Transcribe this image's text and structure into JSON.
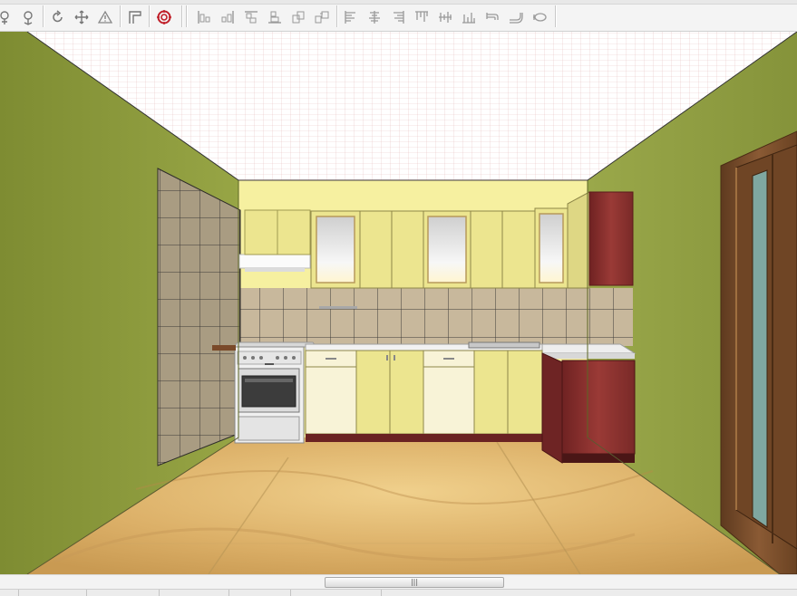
{
  "toolbar": {
    "buttons": [
      {
        "name": "pan-icon"
      },
      {
        "name": "orbit-icon"
      },
      {
        "name": "rotate-icon"
      },
      {
        "name": "move-icon"
      },
      {
        "name": "warning-icon"
      },
      {
        "name": "wall-icon"
      },
      {
        "name": "target-icon"
      },
      {
        "name": "align-left-edges-icon"
      },
      {
        "name": "align-right-edges-icon"
      },
      {
        "name": "align-top-edges-icon"
      },
      {
        "name": "align-bottom-edges-icon"
      },
      {
        "name": "group-icon"
      },
      {
        "name": "ungroup-icon"
      },
      {
        "name": "align-left-icon"
      },
      {
        "name": "align-center-icon"
      },
      {
        "name": "align-right-icon"
      },
      {
        "name": "distribute-top-icon"
      },
      {
        "name": "distribute-middle-icon"
      },
      {
        "name": "distribute-bottom-icon"
      },
      {
        "name": "faucet-icon"
      },
      {
        "name": "pipe-icon"
      },
      {
        "name": "gas-icon"
      }
    ]
  },
  "scrollbar": {
    "thumb_grip": "|||"
  },
  "colors": {
    "walls": "#8c9a3c",
    "back_wall": "#f6f0a0",
    "cabinet_yellow": "#ece58f",
    "cabinet_cream": "#f8f3d7",
    "cabinet_wood": "#8a3030",
    "floor": "#e0b872",
    "tiles": "#a89a80",
    "door": "#7a4c2a",
    "toolbar_red": "#c0202a"
  }
}
